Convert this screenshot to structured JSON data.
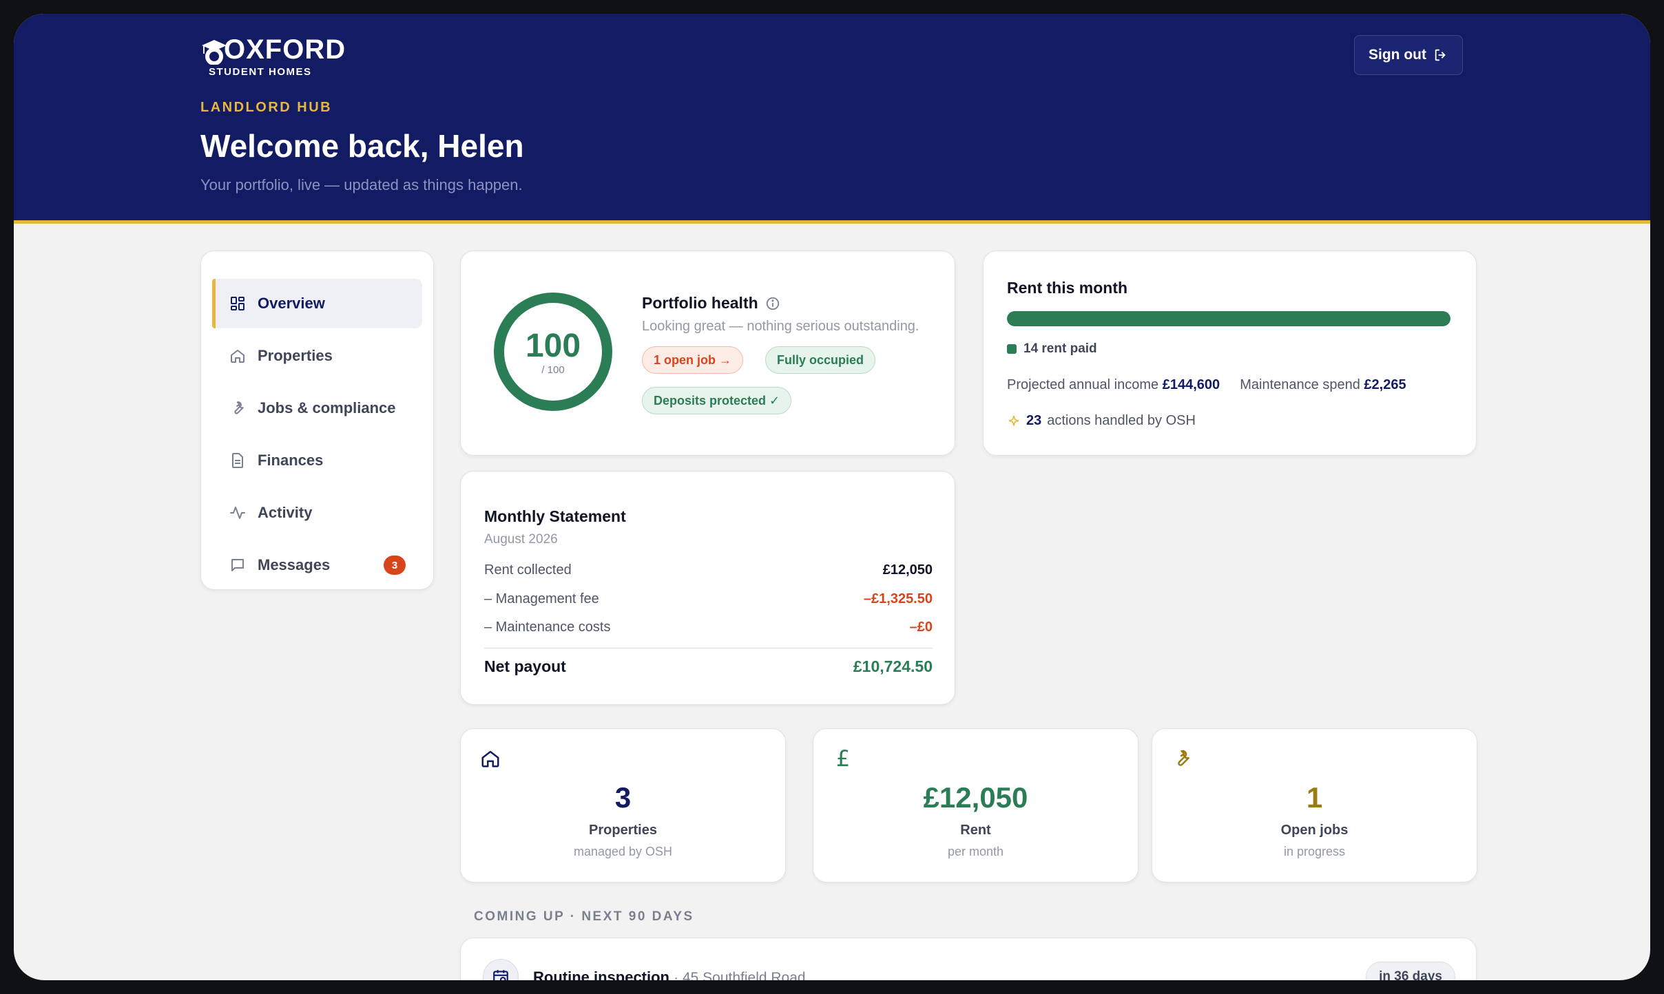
{
  "header": {
    "logo_top": "OXFORD",
    "logo_bottom": "STUDENT HOMES",
    "kicker": "LANDLORD HUB",
    "welcome": "Welcome back, Helen",
    "tagline": "Your portfolio, live — updated as things happen.",
    "signout_label": "Sign out"
  },
  "nav": {
    "items": [
      {
        "label": "Overview",
        "icon": "grid-icon",
        "active": true
      },
      {
        "label": "Properties",
        "icon": "home-icon"
      },
      {
        "label": "Jobs & compliance",
        "icon": "wrench-icon"
      },
      {
        "label": "Finances",
        "icon": "document-icon"
      },
      {
        "label": "Activity",
        "icon": "pulse-icon"
      },
      {
        "label": "Messages",
        "icon": "chat-icon",
        "badge": "3"
      }
    ]
  },
  "health": {
    "score": "100",
    "out_of": "/ 100",
    "title": "Portfolio health",
    "subtitle": "Looking great — nothing serious outstanding.",
    "pill_jobs": "1 open job →",
    "pill_occupied": "Fully occupied",
    "pill_deposits": "Deposits protected ✓"
  },
  "rent": {
    "title": "Rent this month",
    "paid_fraction": 1.0,
    "paid_label": "14 rent paid",
    "projected_label": "Projected annual income",
    "projected_value": "£144,600",
    "maintenance_label": "Maintenance spend",
    "maintenance_value": "£2,265",
    "actions_count": "23",
    "actions_label": "actions handled by OSH"
  },
  "statement": {
    "title": "Monthly Statement",
    "month": "August 2026",
    "rows": [
      {
        "label": "Rent collected",
        "value": "£12,050"
      },
      {
        "label": "– Management fee",
        "value": "–£1,325.50"
      },
      {
        "label": "– Maintenance costs",
        "value": "–£0"
      }
    ],
    "net_label": "Net payout",
    "net_value": "£10,724.50"
  },
  "stats": [
    {
      "icon": "home-icon",
      "value": "3",
      "label": "Properties",
      "sub": "managed by OSH"
    },
    {
      "icon": "pound-icon",
      "value": "£12,050",
      "label": "Rent",
      "sub": "per month"
    },
    {
      "icon": "wrench-icon",
      "value": "1",
      "label": "Open jobs",
      "sub": "in progress"
    }
  ],
  "coming_up": {
    "heading": "COMING UP · NEXT 90 DAYS",
    "items": [
      {
        "title": "Routine inspection",
        "address": "· 45 Southfield Road",
        "when": "in 36 days"
      }
    ]
  },
  "colors": {
    "navy": "#131b63",
    "gold": "#e7b83f",
    "green": "#2b7d55",
    "red": "#d9451a",
    "olive": "#9a7d12"
  }
}
